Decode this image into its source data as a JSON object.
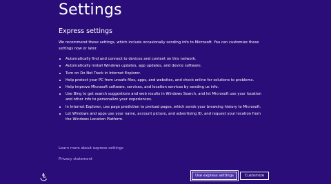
{
  "header": {
    "title": "Settings"
  },
  "main": {
    "section_title": "Express settings",
    "intro": "We recommend these settings, which include occasionally sending info to Microsoft. You can customize these settings now or later.",
    "bullets": [
      "Automatically find and connect to devices and content on this network.",
      "Automatically install Windows updates, app updates, and device software.",
      "Turn on Do Not Track in Internet Explorer.",
      "Help protect your PC from unsafe files, apps, and websites, and check online for solutions to problems.",
      "Help improve Microsoft software, services, and location services by sending us info.",
      "Use Bing to get search suggestions and web results in Windows Search, and let Microsoft use your location and other info to personalize your experiences.",
      "In Internet Explorer, use page prediction to preload pages, which sends your browsing history to Microsoft.",
      "Let Windows and apps use your name, account picture, and advertising ID, and request your location from the Windows Location Platform."
    ]
  },
  "links": {
    "learn_more": "Learn more about express settings",
    "privacy": "Privacy statement"
  },
  "footer": {
    "ease_of_access_icon": "ease-of-access-icon",
    "primary_button": "Use express settings",
    "secondary_button": "Customize"
  },
  "colors": {
    "background": "#2a0d78",
    "link": "#c9b8ff",
    "primary_button_fill": "#4b2fa7"
  }
}
